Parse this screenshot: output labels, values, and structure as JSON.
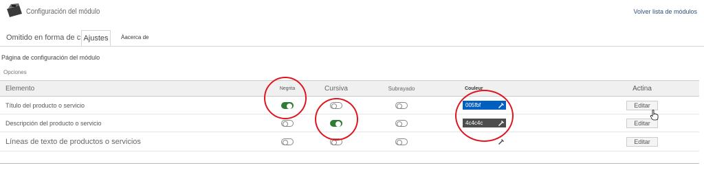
{
  "header": {
    "title": "Configuración del módulo",
    "back_link": "Volver lista de módulos"
  },
  "tabs": [
    {
      "label": "Omitido en forma de citas",
      "active": false
    },
    {
      "label": "Ajustes",
      "active": true
    },
    {
      "label": "Àacerca de",
      "active": false
    }
  ],
  "page_heading": "Página de configuración del módulo",
  "section_label": "Opciones",
  "table": {
    "columns": {
      "element": "Elemento",
      "bold": "Negrita",
      "italic": "Cursiva",
      "underline": "Subrayado",
      "color": "Couleur",
      "action": "Actina"
    },
    "rows": [
      {
        "name": "Título del producto o servicio",
        "bold": true,
        "italic": false,
        "underline": false,
        "color": "005fbf",
        "color_hex": "#005fbf",
        "action": "Editar"
      },
      {
        "name": "Descripción del producto o servicio",
        "bold": false,
        "italic": true,
        "underline": false,
        "color": "4c4c4c",
        "color_hex": "#4c4c4c",
        "action": "Editar"
      },
      {
        "name": "Líneas de texto de productos o servicios",
        "bold": false,
        "italic": false,
        "underline": false,
        "color": "",
        "color_hex": "#ffffff",
        "action": "Editar"
      }
    ]
  },
  "colors": {
    "toggle_on": "#2e7d32",
    "annotation": "#e0141f",
    "link": "#2a4f7a"
  },
  "icons": [
    "module-briefcase-icon",
    "color-picker-icon",
    "hand-cursor-icon"
  ]
}
